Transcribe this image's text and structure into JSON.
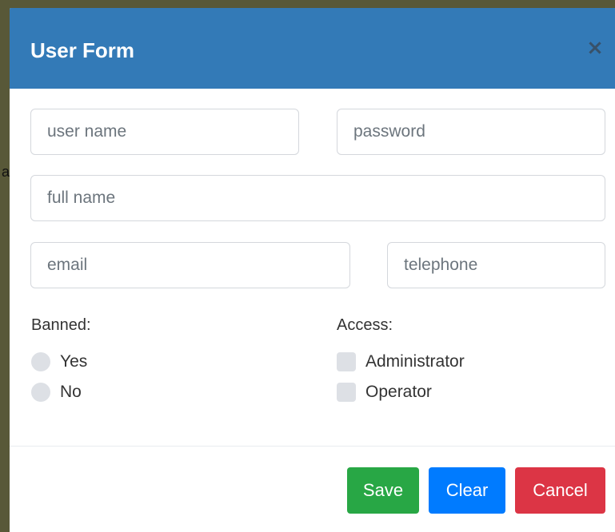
{
  "backdrop": {
    "fragment": "a"
  },
  "dialog": {
    "title": "User Form",
    "close_symbol": "×",
    "close_icon": "close-icon"
  },
  "form": {
    "username": {
      "value": "",
      "placeholder": "user name"
    },
    "password": {
      "value": "",
      "placeholder": "password"
    },
    "fullname": {
      "value": "",
      "placeholder": "full name"
    },
    "email": {
      "value": "",
      "placeholder": "email"
    },
    "telephone": {
      "value": "",
      "placeholder": "telephone"
    }
  },
  "banned": {
    "label": "Banned:",
    "options": [
      {
        "label": "Yes",
        "selected": false
      },
      {
        "label": "No",
        "selected": false
      }
    ]
  },
  "access": {
    "label": "Access:",
    "options": [
      {
        "label": "Administrator",
        "checked": false
      },
      {
        "label": "Operator",
        "checked": false
      }
    ]
  },
  "footer": {
    "save_label": "Save",
    "clear_label": "Clear",
    "cancel_label": "Cancel"
  },
  "colors": {
    "header": "#337ab7",
    "save": "#28a745",
    "clear": "#007bff",
    "cancel": "#dc3545",
    "backdrop": "#585838"
  }
}
